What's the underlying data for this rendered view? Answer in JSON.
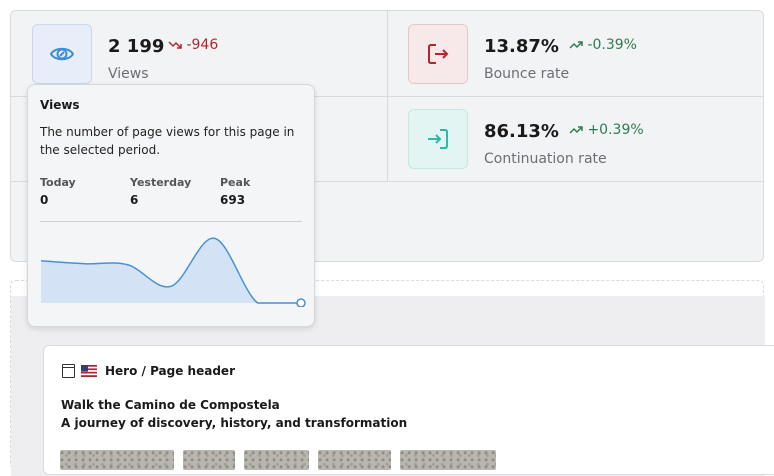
{
  "stats": {
    "views": {
      "value": "2 199",
      "delta": "-946",
      "label": "Views",
      "trend": "down"
    },
    "bounce": {
      "value": "13.87%",
      "delta": "-0.39%",
      "label": "Bounce rate",
      "trend": "up"
    },
    "continuation": {
      "value": "86.13%",
      "delta": "+0.39%",
      "label": "Continuation rate",
      "trend": "up"
    }
  },
  "tooltip": {
    "title": "Views",
    "description": "The number of page views for this page in the selected period.",
    "metrics": [
      {
        "label": "Today",
        "value": "0"
      },
      {
        "label": "Yesterday",
        "value": "6"
      },
      {
        "label": "Peak",
        "value": "693"
      }
    ]
  },
  "chart_data": {
    "type": "area",
    "title": "",
    "xlabel": "",
    "ylabel": "",
    "ylim": [
      0,
      693
    ],
    "grid": false,
    "series": [
      {
        "values": [
          430,
          400,
          390,
          170,
          660,
          0,
          0
        ]
      }
    ]
  },
  "card": {
    "content_type": "Hero / Page header",
    "heading": "Walk the Camino de Compostela",
    "subheading": "A journey of discovery, history, and transformation"
  },
  "colors": {
    "views_accent": "#3b8ed8",
    "bounce_accent": "#b3262d",
    "continuation_accent": "#2fb7a8",
    "chart_line": "#4a90d9",
    "chart_fill": "#d3e3f5"
  },
  "icons": {
    "views": "eye-icon",
    "bounce": "exit-icon",
    "continuation": "enter-icon",
    "trend_down": "trend-down-icon",
    "trend_up": "trend-up-icon"
  }
}
